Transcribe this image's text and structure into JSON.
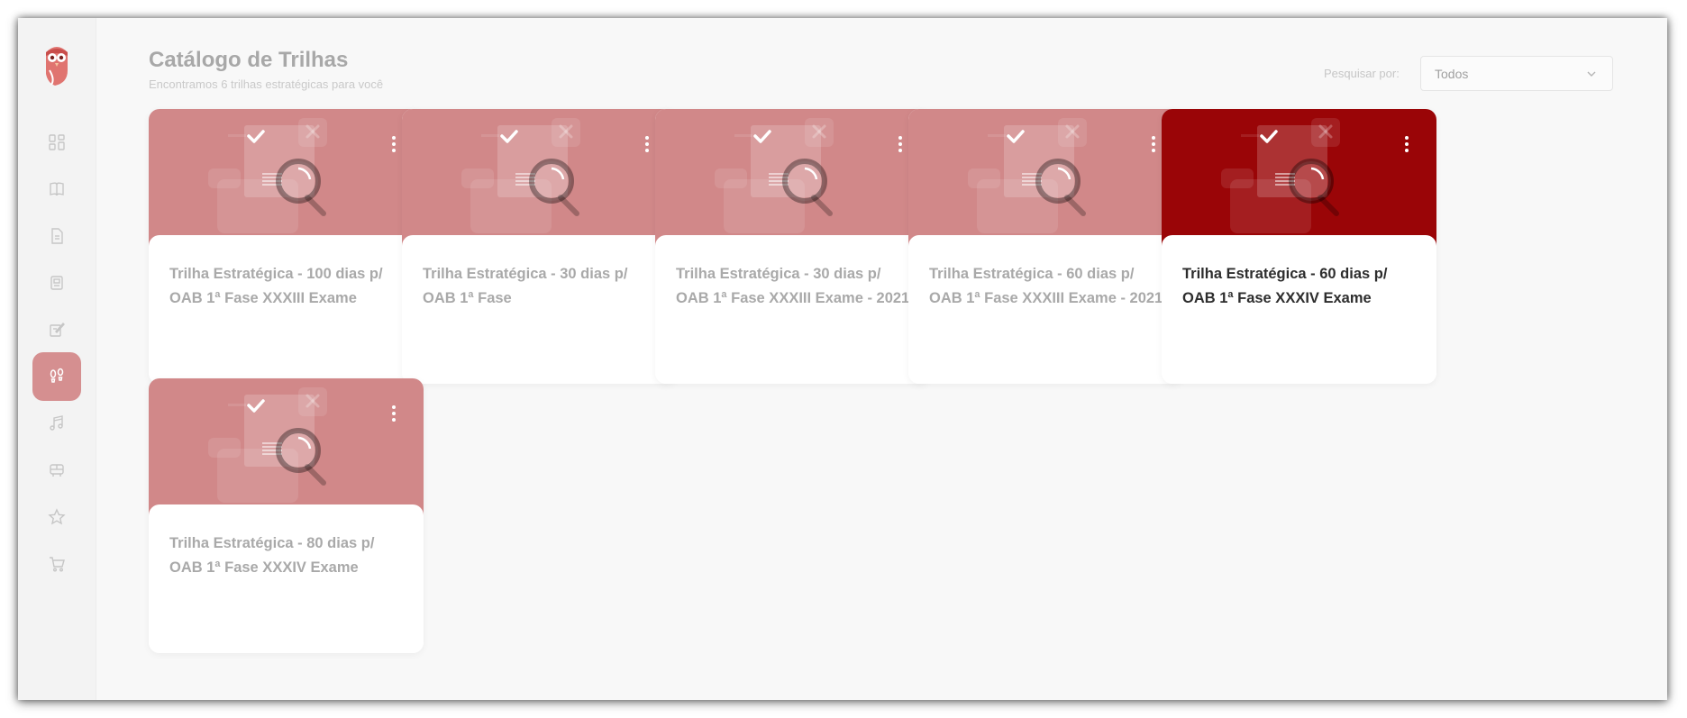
{
  "colors": {
    "accent": "#9a0507",
    "accent_faded": "#d18889",
    "nav_active": "#d58f90"
  },
  "sidebar": {
    "items": [
      {
        "icon": "dashboard-icon",
        "active": false
      },
      {
        "icon": "book-icon",
        "active": false
      },
      {
        "icon": "document-icon",
        "active": false
      },
      {
        "icon": "notebook-icon",
        "active": false
      },
      {
        "icon": "edit-note-icon",
        "active": false
      },
      {
        "icon": "footprints-icon",
        "active": true
      },
      {
        "icon": "music-icon",
        "active": false
      },
      {
        "icon": "bus-icon",
        "active": false
      },
      {
        "icon": "star-icon",
        "active": false
      },
      {
        "icon": "cart-icon",
        "active": false
      }
    ]
  },
  "header": {
    "title": "Catálogo de Trilhas",
    "subtitle": "Encontramos 6 trilhas estratégicas para você"
  },
  "search": {
    "label": "Pesquisar por:",
    "selected": "Todos"
  },
  "cards": [
    {
      "title": "Trilha Estratégica - 100 dias p/ OAB 1ª Fase XXXIII Exame",
      "active": false
    },
    {
      "title": "Trilha Estratégica - 30 dias p/ OAB 1ª Fase",
      "active": false
    },
    {
      "title": "Trilha Estratégica - 30 dias p/ OAB 1ª Fase XXXIII Exame - 2021",
      "active": false
    },
    {
      "title": "Trilha Estratégica - 60 dias p/ OAB 1ª Fase XXXIII Exame - 2021",
      "active": false
    },
    {
      "title": "Trilha Estratégica - 60 dias p/ OAB 1ª Fase XXXIV Exame",
      "active": true
    },
    {
      "title": "Trilha Estratégica - 80 dias p/ OAB 1ª Fase XXXIV Exame",
      "active": false
    }
  ]
}
